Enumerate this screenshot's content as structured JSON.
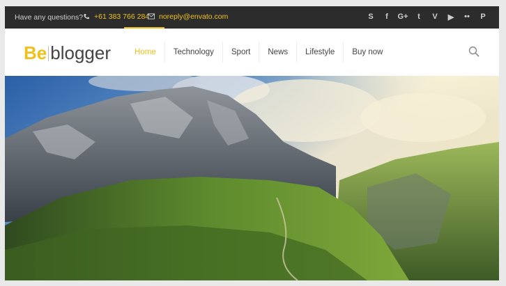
{
  "topbar": {
    "question": "Have any questions?",
    "phone": "+61 383 766 284",
    "email": "noreply@envato.com",
    "icons": [
      "phone-icon",
      "mail-icon"
    ]
  },
  "social": [
    {
      "name": "skype-icon",
      "glyph": "S"
    },
    {
      "name": "facebook-icon",
      "glyph": "f"
    },
    {
      "name": "google-plus-icon",
      "glyph": "G+"
    },
    {
      "name": "twitter-icon",
      "glyph": "t"
    },
    {
      "name": "vimeo-icon",
      "glyph": "V"
    },
    {
      "name": "youtube-icon",
      "glyph": "▶"
    },
    {
      "name": "flickr-icon",
      "glyph": "••"
    },
    {
      "name": "pinterest-icon",
      "glyph": "P"
    }
  ],
  "logo": {
    "part1": "Be",
    "part2": "blogger"
  },
  "nav": {
    "items": [
      {
        "label": "Home",
        "active": true
      },
      {
        "label": "Technology"
      },
      {
        "label": "Sport"
      },
      {
        "label": "News"
      },
      {
        "label": "Lifestyle"
      },
      {
        "label": "Buy now"
      }
    ]
  },
  "colors": {
    "accent": "#f0c11b",
    "topbar": "#2c2c2c",
    "text": "#444444"
  },
  "hero": {
    "icon": "mountain-landscape-image"
  }
}
